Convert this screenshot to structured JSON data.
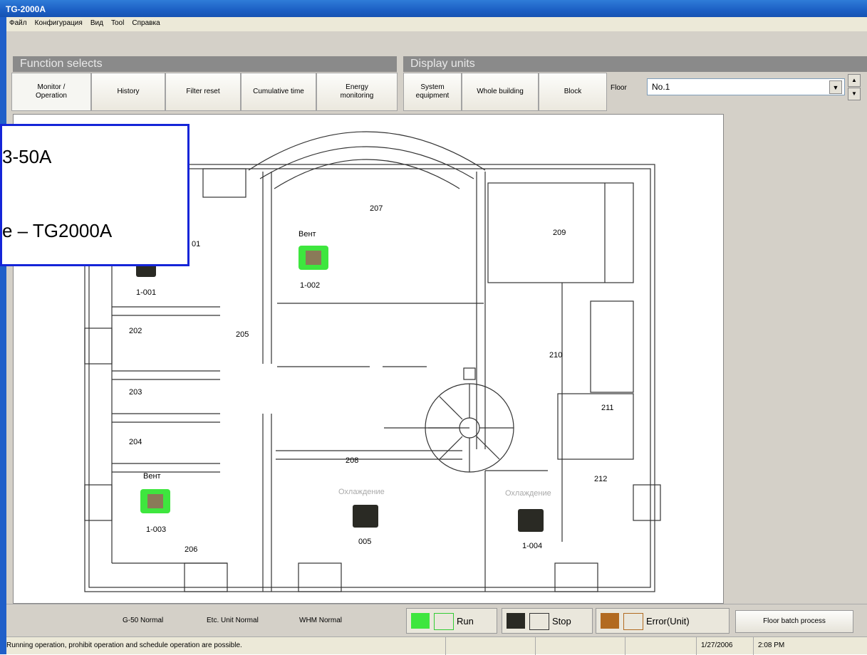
{
  "window": {
    "title": "TG-2000A"
  },
  "menu": [
    "Файл",
    "Конфигурация",
    "Вид",
    "Tool",
    "Справка"
  ],
  "function_selects": {
    "header": "Function selects",
    "buttons": [
      {
        "label": "Monitor / Operation",
        "active": true
      },
      {
        "label": "History"
      },
      {
        "label": "Filter reset"
      },
      {
        "label": "Cumulative time"
      },
      {
        "label": "Energy monitoring"
      }
    ]
  },
  "display_units": {
    "header": "Display units",
    "buttons": [
      {
        "label": "System equipment"
      },
      {
        "label": "Whole building"
      },
      {
        "label": "Block"
      }
    ]
  },
  "floor": {
    "label": "Floor",
    "value": "No.1"
  },
  "rooms": [
    "207",
    "209",
    "01",
    "202",
    "205",
    "210",
    "203",
    "211",
    "204",
    "208",
    "212",
    "206"
  ],
  "units": [
    {
      "id": "1-001",
      "mode": ""
    },
    {
      "id": "1-002",
      "mode": "Вент"
    },
    {
      "id": "1-003",
      "mode": "Вент"
    },
    {
      "id": "005",
      "mode": "Охлаждение"
    },
    {
      "id": "1-004",
      "mode": "Охлаждение"
    }
  ],
  "status": {
    "g50": "G-50  Normal",
    "etc": "Etc. Unit Normal",
    "whm": "WHM  Normal",
    "legend_run": "Run",
    "legend_stop": "Stop",
    "legend_error": "Error(Unit)",
    "floor_batch": "Floor batch process",
    "message": "Running operation, prohibit operation and schedule operation are possible.",
    "date": "1/27/2006",
    "time": "2:08 PM"
  },
  "overlay": {
    "line1": "3-50A",
    "line2": "e – TG2000A"
  },
  "colors": {
    "title_bar": "#1c5fc4",
    "run": "#3ee63e",
    "overlay_border": "#1525d8"
  }
}
